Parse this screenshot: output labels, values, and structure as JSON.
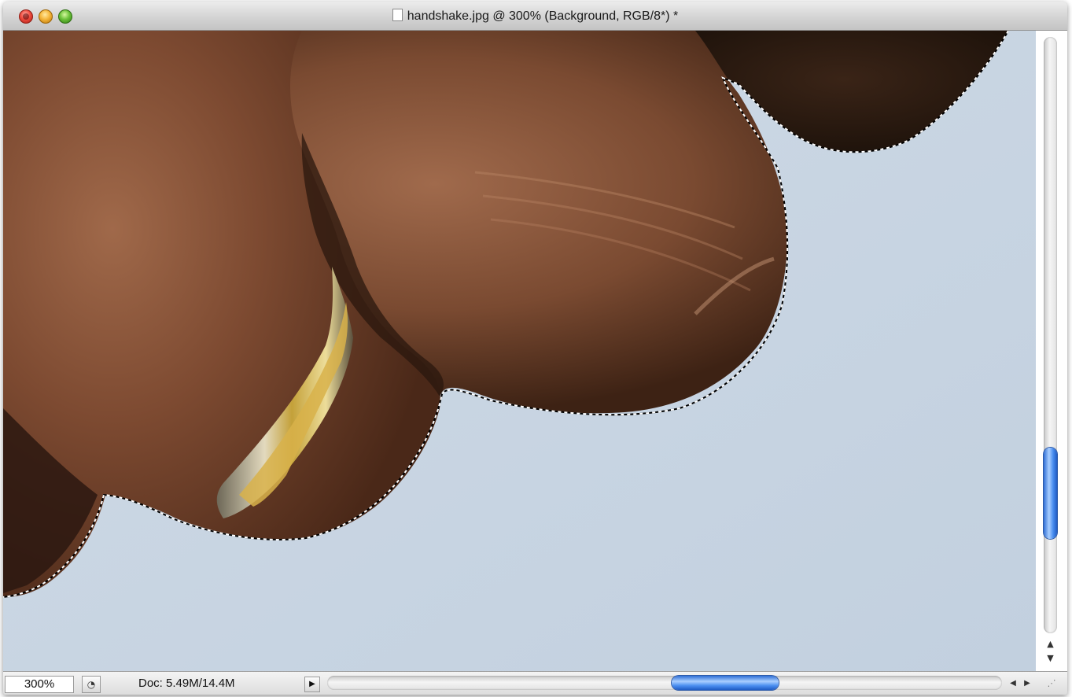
{
  "window": {
    "title": "handshake.jpg @ 300% (Background, RGB/8*) *",
    "controls": {
      "close_icon": "close-icon",
      "minimize_icon": "minimize-icon",
      "zoom_icon": "zoom-icon"
    }
  },
  "canvas": {
    "image_content": "zoomed photo of fingers with selection marquee",
    "background_color": "#c9d6e3"
  },
  "statusbar": {
    "zoom_level": "300%",
    "quick_mask_icon": "quick-mask-icon",
    "doc_info": "Doc: 5.49M/14.4M",
    "info_menu_arrow": "▶"
  },
  "scrollbars": {
    "vertical_up_arrow": "▲",
    "vertical_down_arrow": "▼",
    "horizontal_left_arrow": "◀",
    "horizontal_right_arrow": "▶",
    "resize_grip": "⋰"
  }
}
